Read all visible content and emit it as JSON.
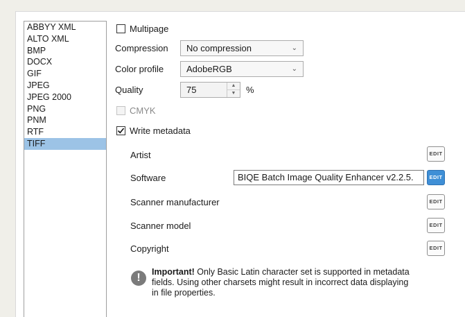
{
  "formats": [
    "ABBYY XML",
    "ALTO XML",
    "BMP",
    "DOCX",
    "GIF",
    "JPEG",
    "JPEG 2000",
    "PNG",
    "PNM",
    "RTF",
    "TIFF"
  ],
  "selected_format": "TIFF",
  "options": {
    "multipage_label": "Multipage",
    "compression_label": "Compression",
    "compression_value": "No compression",
    "color_profile_label": "Color profile",
    "color_profile_value": "AdobeRGB",
    "quality_label": "Quality",
    "quality_value": "75",
    "quality_unit": "%",
    "cmyk_label": "CMYK",
    "write_metadata_label": "Write metadata",
    "multipage_checked": false,
    "cmyk_checked": false,
    "write_metadata_checked": true
  },
  "metadata": {
    "edit_label": "EDIT",
    "artist_label": "Artist",
    "software_label": "Software",
    "software_value": "BIQE Batch Image Quality Enhancer v2.2.5.",
    "scanner_manufacturer_label": "Scanner manufacturer",
    "scanner_model_label": "Scanner model",
    "copyright_label": "Copyright"
  },
  "note": {
    "bold": "Important!",
    "line1": " Only Basic Latin character set is supported in metadata",
    "line2": "fields. Using other charsets might result in incorrect data displaying",
    "line3": "in file properties."
  },
  "colors": {
    "selection": "#9cc3e6",
    "edit_active": "#3f8fd6"
  }
}
